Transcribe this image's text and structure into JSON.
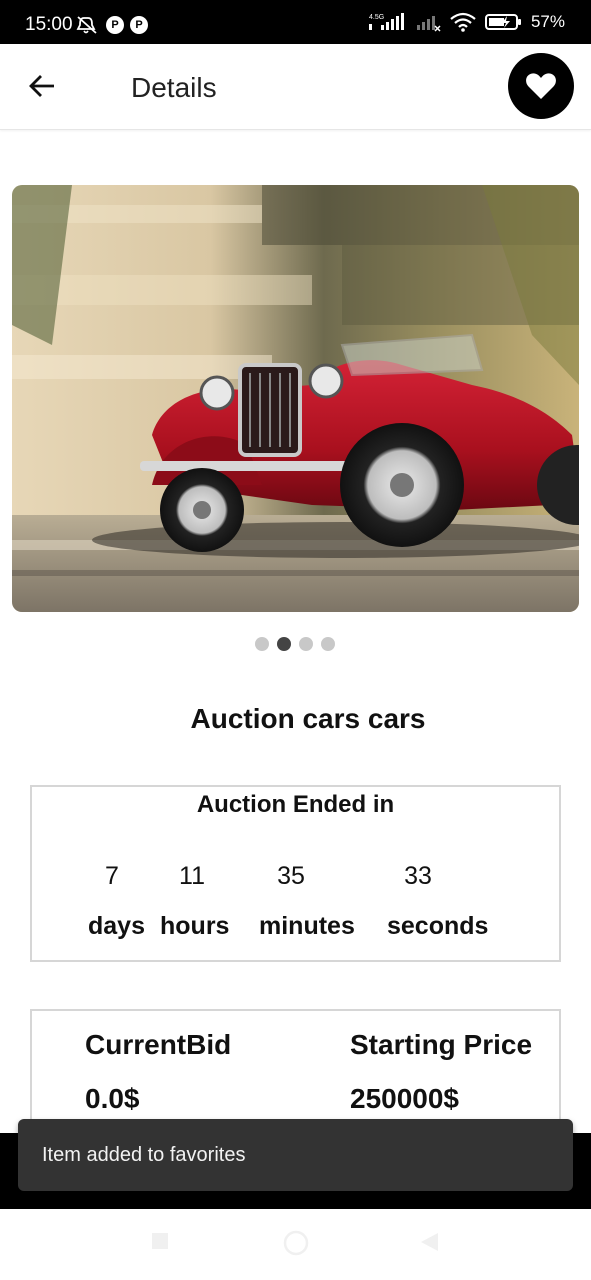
{
  "status_bar": {
    "time": "15:00",
    "network_label": "4.5G",
    "battery_percent": "57%",
    "icons": [
      "mute-icon",
      "notification-icon",
      "notification-icon",
      "signal-icon",
      "signal-icon",
      "wifi-icon",
      "battery-charging-icon"
    ]
  },
  "app_bar": {
    "title": "Details",
    "back_icon": "arrow-left-icon",
    "favorite_icon": "heart-icon"
  },
  "carousel": {
    "image_subject": "red vintage convertible car",
    "page_count": 4,
    "active_index": 1
  },
  "item": {
    "title": "Auction cars cars"
  },
  "countdown": {
    "title": "Auction Ended in",
    "days_value": "7",
    "hours_value": "11",
    "minutes_value": "35",
    "seconds_value": "33",
    "days_label": "days",
    "hours_label": "hours",
    "minutes_label": "minutes",
    "seconds_label": "seconds"
  },
  "prices": {
    "current_bid_label": "CurrentBid",
    "current_bid_value": "0.0$",
    "starting_price_label": "Starting Price",
    "starting_price_value": "250000$"
  },
  "snackbar": {
    "message": "Item added to favorites"
  },
  "colors": {
    "accent": "#000000",
    "car_red": "#b0121f",
    "snackbar_bg": "#333333"
  }
}
